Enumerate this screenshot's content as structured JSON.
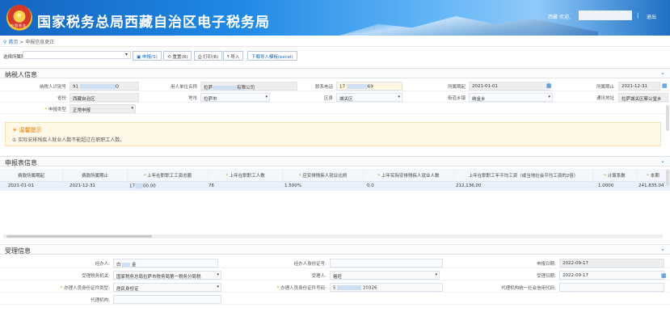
{
  "header": {
    "title": "国家税务总局西藏自治区电子税务局",
    "emblem_text": "中国税务",
    "welcome": "欢迎,",
    "welcome_prefix": "西藏",
    "separator": "|",
    "logout": "退出"
  },
  "breadcrumb": {
    "home": "首页",
    "sep": ">",
    "current": "申报信息更正"
  },
  "toolbar": {
    "label": "选择所属期:",
    "buttons": [
      "申报(S)",
      "重置(R)",
      "打印(B)",
      "导入",
      "下载导入模板(excel)"
    ]
  },
  "taxpayer": {
    "section_title": "纳税人信息",
    "id_label": "纳税人识别号",
    "id_value": "91",
    "id_value_end": "Q",
    "company_label": "用人单位名称",
    "company_value": "拉萨",
    "company_value_end": "有限公司",
    "phone_label": "联系电话",
    "phone_value": "17",
    "phone_value_end": "69",
    "period_start_label": "所属期起",
    "period_start": "2021-01-01",
    "period_end_label": "所属期止",
    "period_end": "2021-12-31",
    "province_label": "省份",
    "province": "西藏自治区",
    "city_label": "地市",
    "city": "拉萨市",
    "district_label": "区县",
    "district": "城关区",
    "street_label": "街道乡镇",
    "street": "纳金乡",
    "address_label": "通讯地址",
    "address": "拉萨城关区蔡公堂乡",
    "decl_type_label": "申报类型",
    "decl_type": "正常申报"
  },
  "tip": {
    "title": "温馨提示",
    "body": "① 实际安排残疾人就业人数不能超过在职职工人数。"
  },
  "table": {
    "section_title": "申报表信息",
    "headers": [
      "费款所属期起",
      "费款所属期止",
      "上年在职职工工资总额",
      "上年在职职工人数",
      "应安排残疾人就业比例",
      "上年实际安排残疾人就业人数",
      "上年在职职工年平均工资（或当地社会平均工资的2倍）",
      "计算系数",
      "本期"
    ],
    "rows": [
      [
        "2021-01-01",
        "2021-12-31",
        "17",
        "00.00",
        "76",
        "1.500%",
        "0.0",
        "212,136.00",
        "1.0000",
        "241,835.04"
      ]
    ]
  },
  "acceptance": {
    "section_title": "受理信息",
    "handler_label": "经办人:",
    "handler": "白",
    "handler_end": "金",
    "handler_id_label": "经办人身份证号:",
    "handler_id": "",
    "decl_date_label": "申报日期:",
    "decl_date": "2022-09-17",
    "tax_org_label": "受理税务机关:",
    "tax_org": "国家税务总局拉萨市税务局第一税务分局税",
    "receiver_label": "受理人:",
    "receiver": "格旺",
    "accept_date_label": "受理日期:",
    "accept_date": "2022-09-17",
    "agent_id_type_label": "办理人员身份证件类型:",
    "agent_id_type": "居民身份证",
    "agent_id_no_label": "办理人员身份证件号码:",
    "agent_id_no": "5",
    "agent_id_no_end": "20326",
    "agency_code_label": "代理机构统一社会信用代码:",
    "agency_code": "",
    "agency_label": "代理机构:",
    "agency": ""
  },
  "colors": {
    "header_blue": "#1565c0",
    "link_blue": "#1976d2",
    "required": "#e08a00"
  }
}
